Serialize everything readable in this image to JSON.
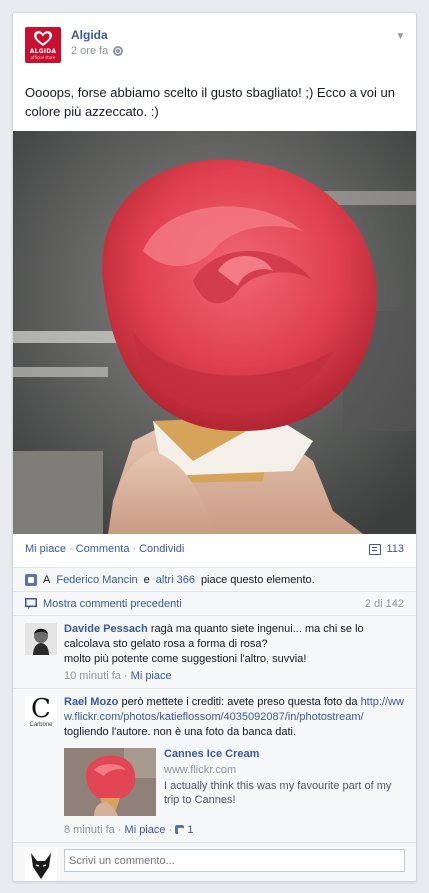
{
  "post": {
    "page_name": "Algida",
    "logo_text": "ALGIDA",
    "logo_subtext": "official store",
    "time": "2 ore fa",
    "text": "Oooops, forse abbiamo scelto il gusto sbagliato! ;) Ecco a voi un colore più azzeccato. :)"
  },
  "actions": {
    "like": "Mi piace",
    "comment": "Commenta",
    "share": "Condividi",
    "comment_count": "113"
  },
  "likes": {
    "prefix": "A",
    "person": "Federico Mancin",
    "conj": "e",
    "others": "altri 366",
    "suffix": "piace questo elemento."
  },
  "previous": {
    "label": "Mostra commenti precedenti",
    "counter": "2 di 142"
  },
  "comments": [
    {
      "name": "Davide Pessach",
      "text": "ragà ma quanto siete ingenui... ma chi se lo calcolava sto gelato rosa a forma di rosa?",
      "text2": "molto più potente come suggestioni l'altro, suvvia!",
      "time": "10 minuti fa",
      "like": "Mi piace"
    },
    {
      "name": "Rael Mozo",
      "text_a": "però mettete i crediti: avete preso questa foto da",
      "link": "http://www.flickr.com/photos/katieflossom/4035092087/in/photostream/",
      "text_b": "togliendo l'autore. non è una foto da banca dati.",
      "avatar_letter": "C",
      "avatar_label": "Carbone",
      "share_title": "Cannes Ice Cream",
      "share_url": "www.flickr.com",
      "share_desc": "I actually think this was my favourite part of my trip to Cannes!",
      "time": "8 minuti fa",
      "like": "Mi piace",
      "likes": "1"
    }
  ],
  "composer": {
    "placeholder": "Scrivi un commento..."
  },
  "colors": {
    "link": "#3b5998",
    "brand": "#c8102e"
  }
}
